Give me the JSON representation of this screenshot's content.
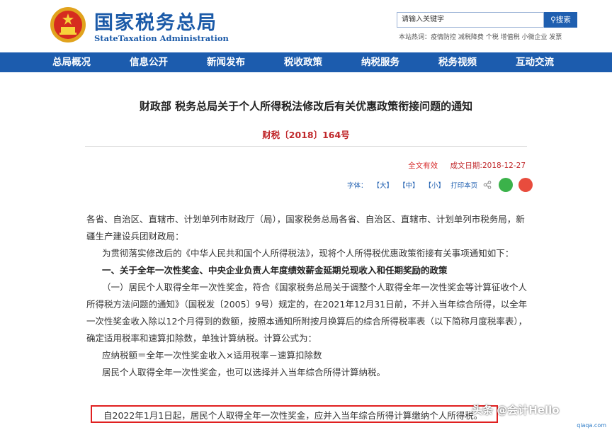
{
  "header": {
    "brand_cn": "国家税务总局",
    "brand_en": "StateTaxation Administration",
    "search_placeholder": "请输入关键字",
    "search_button": "搜索",
    "hot_words": "本站热词：疫情防控 减税降费 个税 增值税 小微企业 发票"
  },
  "nav": {
    "items": [
      "总局概况",
      "信息公开",
      "新闻发布",
      "税收政策",
      "纳税服务",
      "税务视频",
      "互动交流"
    ]
  },
  "article": {
    "title": "财政部 税务总局关于个人所得税法修改后有关优惠政策衔接问题的通知",
    "doc_number": "财税〔2018〕164号",
    "validity": "全文有效",
    "date": "成文日期:2018-12-27",
    "tools": {
      "font_label": "字体：",
      "large": "【大】",
      "medium": "【中】",
      "small": "【小】",
      "print": "打印本页"
    },
    "paragraphs": {
      "p1_line1": "各省、自治区、直辖市、计划单列市财政厅（局），国家税务总局各省、自治区、直辖市、计划单列市税务局，新",
      "p1_line2": "疆生产建设兵团财政局：",
      "p2": "为贯彻落实修改后的《中华人民共和国个人所得税法》，现将个人所得税优惠政策衔接有关事项通知如下：",
      "heading1": "一、关于全年一次性奖金、中央企业负责人年度绩效薪金延期兑现收入和任期奖励的政策",
      "p3_line1": "（一）居民个人取得全年一次性奖金，符合《国家税务总局关于调整个人取得全年一次性奖金等计算征收个人",
      "p3_line2": "所得税方法问题的通知》（国税发〔2005〕9号）规定的，在2021年12月31日前，不并入当年综合所得，以全年",
      "p3_line3": "一次性奖金收入除以12个月得到的数额，按照本通知所附按月换算后的综合所得税率表（以下简称月度税率表），",
      "p3_line4": "确定适用税率和速算扣除数，单独计算纳税。计算公式为：",
      "formula": "应纳税额＝全年一次性奖金收入×适用税率－速算扣除数",
      "p4": "居民个人取得全年一次性奖金，也可以选择并入当年综合所得计算纳税。",
      "p5_highlight": "自2022年1月1日起，居民个人取得全年一次性奖金，应并入当年综合所得计算缴纳个人所得税。"
    }
  },
  "watermark": {
    "text": "头条 @会计Hello",
    "url": "qiaqa.com"
  },
  "colors": {
    "brand_blue": "#1b5aa8",
    "nav_blue": "#1c5cae",
    "doc_red": "#c0282b",
    "highlight_red": "#e02020"
  }
}
